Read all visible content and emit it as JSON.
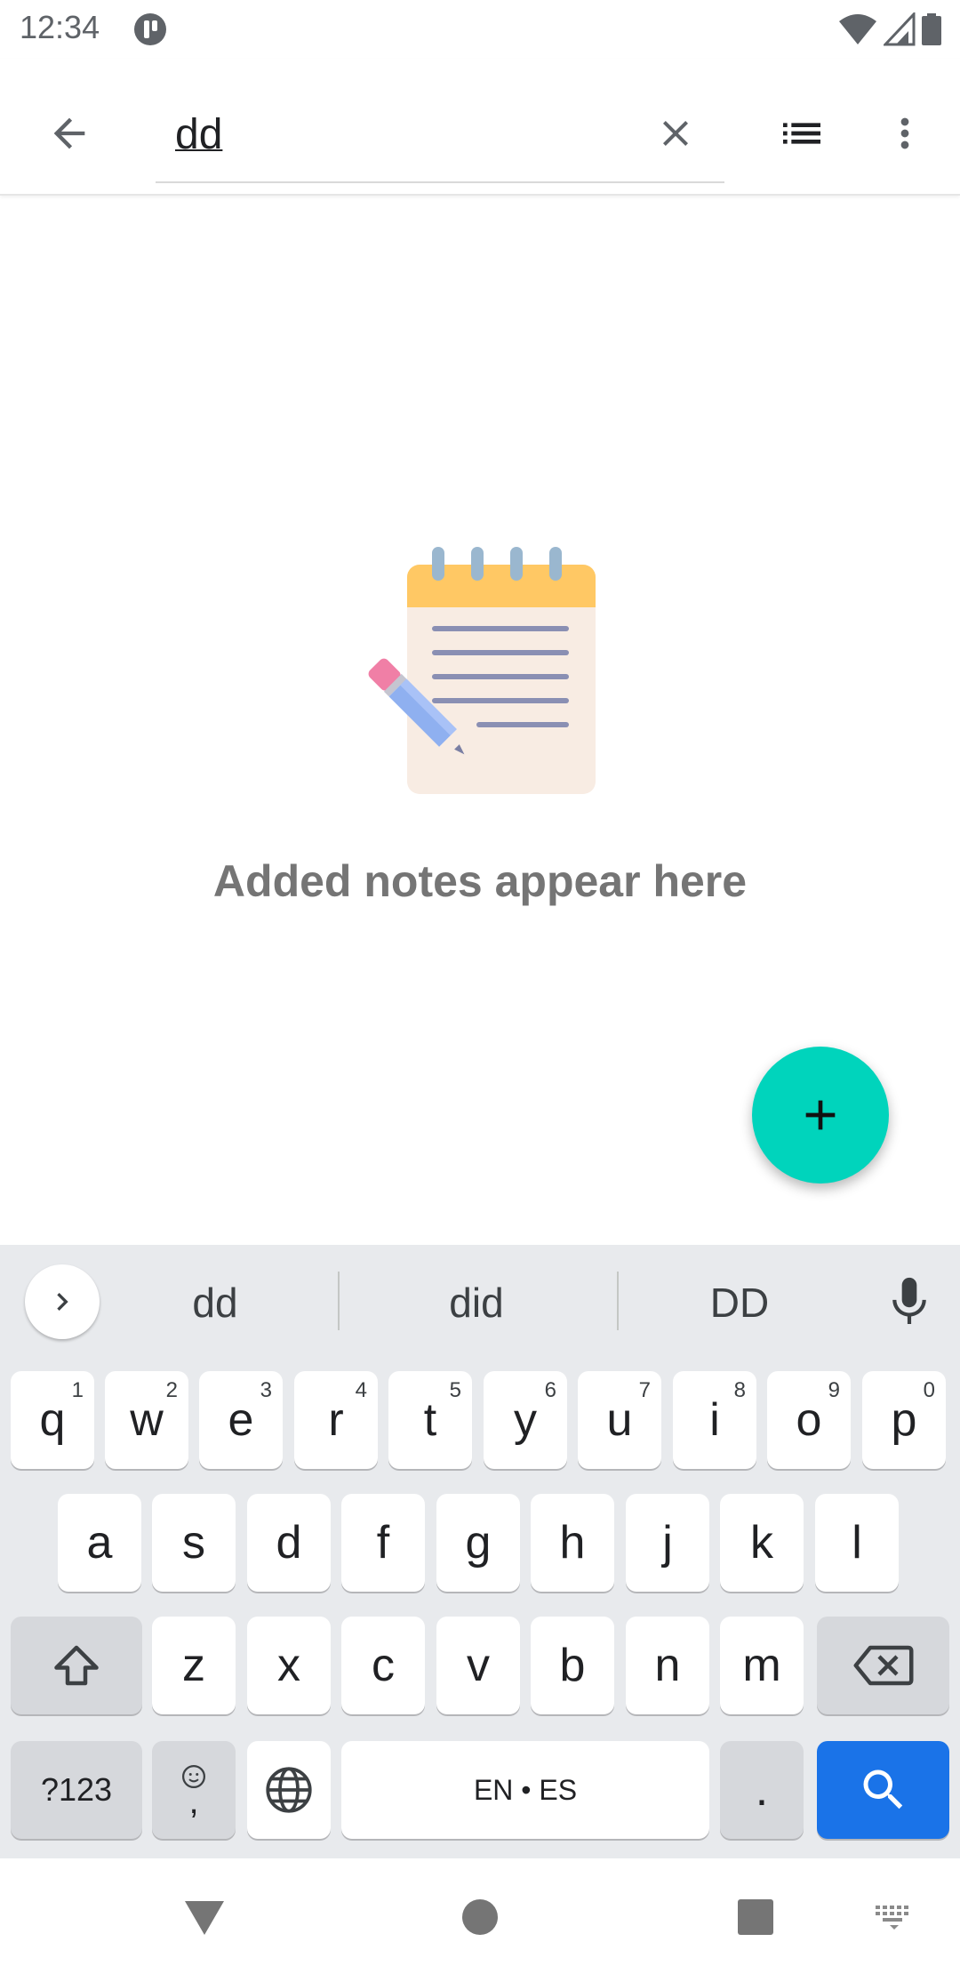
{
  "status_bar": {
    "time": "12:34",
    "icons": [
      "app-notification-icon",
      "wifi-icon",
      "signal-icon",
      "battery-icon"
    ]
  },
  "app_bar": {
    "back_icon": "arrow-back-icon",
    "search": {
      "value": "dd",
      "placeholder": ""
    },
    "clear_icon": "close-icon",
    "view_toggle_icon": "list-view-icon",
    "more_icon": "more-vert-icon"
  },
  "empty_state": {
    "illustration": "notepad-pencil-illustration",
    "message": "Added notes appear here"
  },
  "fab": {
    "icon": "plus-icon",
    "color": "#00d4bc"
  },
  "keyboard": {
    "suggestions": [
      "dd",
      "did",
      "DD"
    ],
    "row1": [
      {
        "label": "q",
        "hint": "1"
      },
      {
        "label": "w",
        "hint": "2"
      },
      {
        "label": "e",
        "hint": "3"
      },
      {
        "label": "r",
        "hint": "4"
      },
      {
        "label": "t",
        "hint": "5"
      },
      {
        "label": "y",
        "hint": "6"
      },
      {
        "label": "u",
        "hint": "7"
      },
      {
        "label": "i",
        "hint": "8"
      },
      {
        "label": "o",
        "hint": "9"
      },
      {
        "label": "p",
        "hint": "0"
      }
    ],
    "row2": [
      "a",
      "s",
      "d",
      "f",
      "g",
      "h",
      "j",
      "k",
      "l"
    ],
    "row3": [
      "z",
      "x",
      "c",
      "v",
      "b",
      "n",
      "m"
    ],
    "symbols_label": "?123",
    "comma_label": ",",
    "space_label": "EN • ES",
    "period_label": ".",
    "search_key_color": "#1a73e8"
  },
  "nav_bar": {
    "icons": [
      "back-triangle-icon",
      "home-circle-icon",
      "recents-square-icon",
      "keyboard-switch-icon"
    ]
  },
  "colors": {
    "accent": "#00d4bc",
    "cursor": "#00bfa5"
  }
}
